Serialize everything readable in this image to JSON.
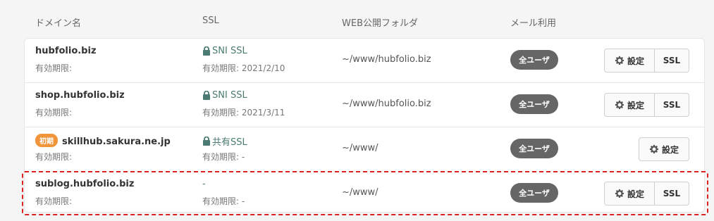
{
  "headers": {
    "domain": "ドメイン名",
    "ssl": "SSL",
    "folder": "WEB公開フォルダ",
    "mail": "メール利用"
  },
  "rows": [
    {
      "domain": "hubfolio.biz",
      "initial_badge": "",
      "expiry": "有効期限:",
      "ssl_name": "SNI SSL",
      "ssl_expiry": "有効期限: 2021/2/10",
      "folder": "~/www/hubfolio.biz",
      "mail": "全ユーザ",
      "settings_label": "設定",
      "ssl_button_label": "SSL"
    },
    {
      "domain": "shop.hubfolio.biz",
      "initial_badge": "",
      "expiry": "有効期限:",
      "ssl_name": "SNI SSL",
      "ssl_expiry": "有効期限: 2021/3/11",
      "folder": "~/www/hubfolio.biz",
      "mail": "全ユーザ",
      "settings_label": "設定",
      "ssl_button_label": "SSL"
    },
    {
      "domain": "skillhub.sakura.ne.jp",
      "initial_badge": "初期",
      "expiry": "有効期限:",
      "ssl_name": "共有SSL",
      "ssl_expiry": "有効期限: -",
      "folder": "~/www/",
      "mail": "全ユーザ",
      "settings_label": "設定",
      "ssl_button_label": ""
    },
    {
      "domain": "sublog.hubfolio.biz",
      "initial_badge": "",
      "expiry": "有効期限:",
      "ssl_name": "-",
      "ssl_expiry": "有効期限: -",
      "folder": "~/www/",
      "mail": "全ユーザ",
      "settings_label": "設定",
      "ssl_button_label": "SSL"
    }
  ],
  "colors": {
    "ssl_green": "#4a7a72",
    "mail_badge": "#666666",
    "initial_badge": "#f0953a",
    "highlight_dashed": "#dd2222"
  },
  "icons": {
    "lock": "lock-icon",
    "gear": "gear-icon"
  }
}
